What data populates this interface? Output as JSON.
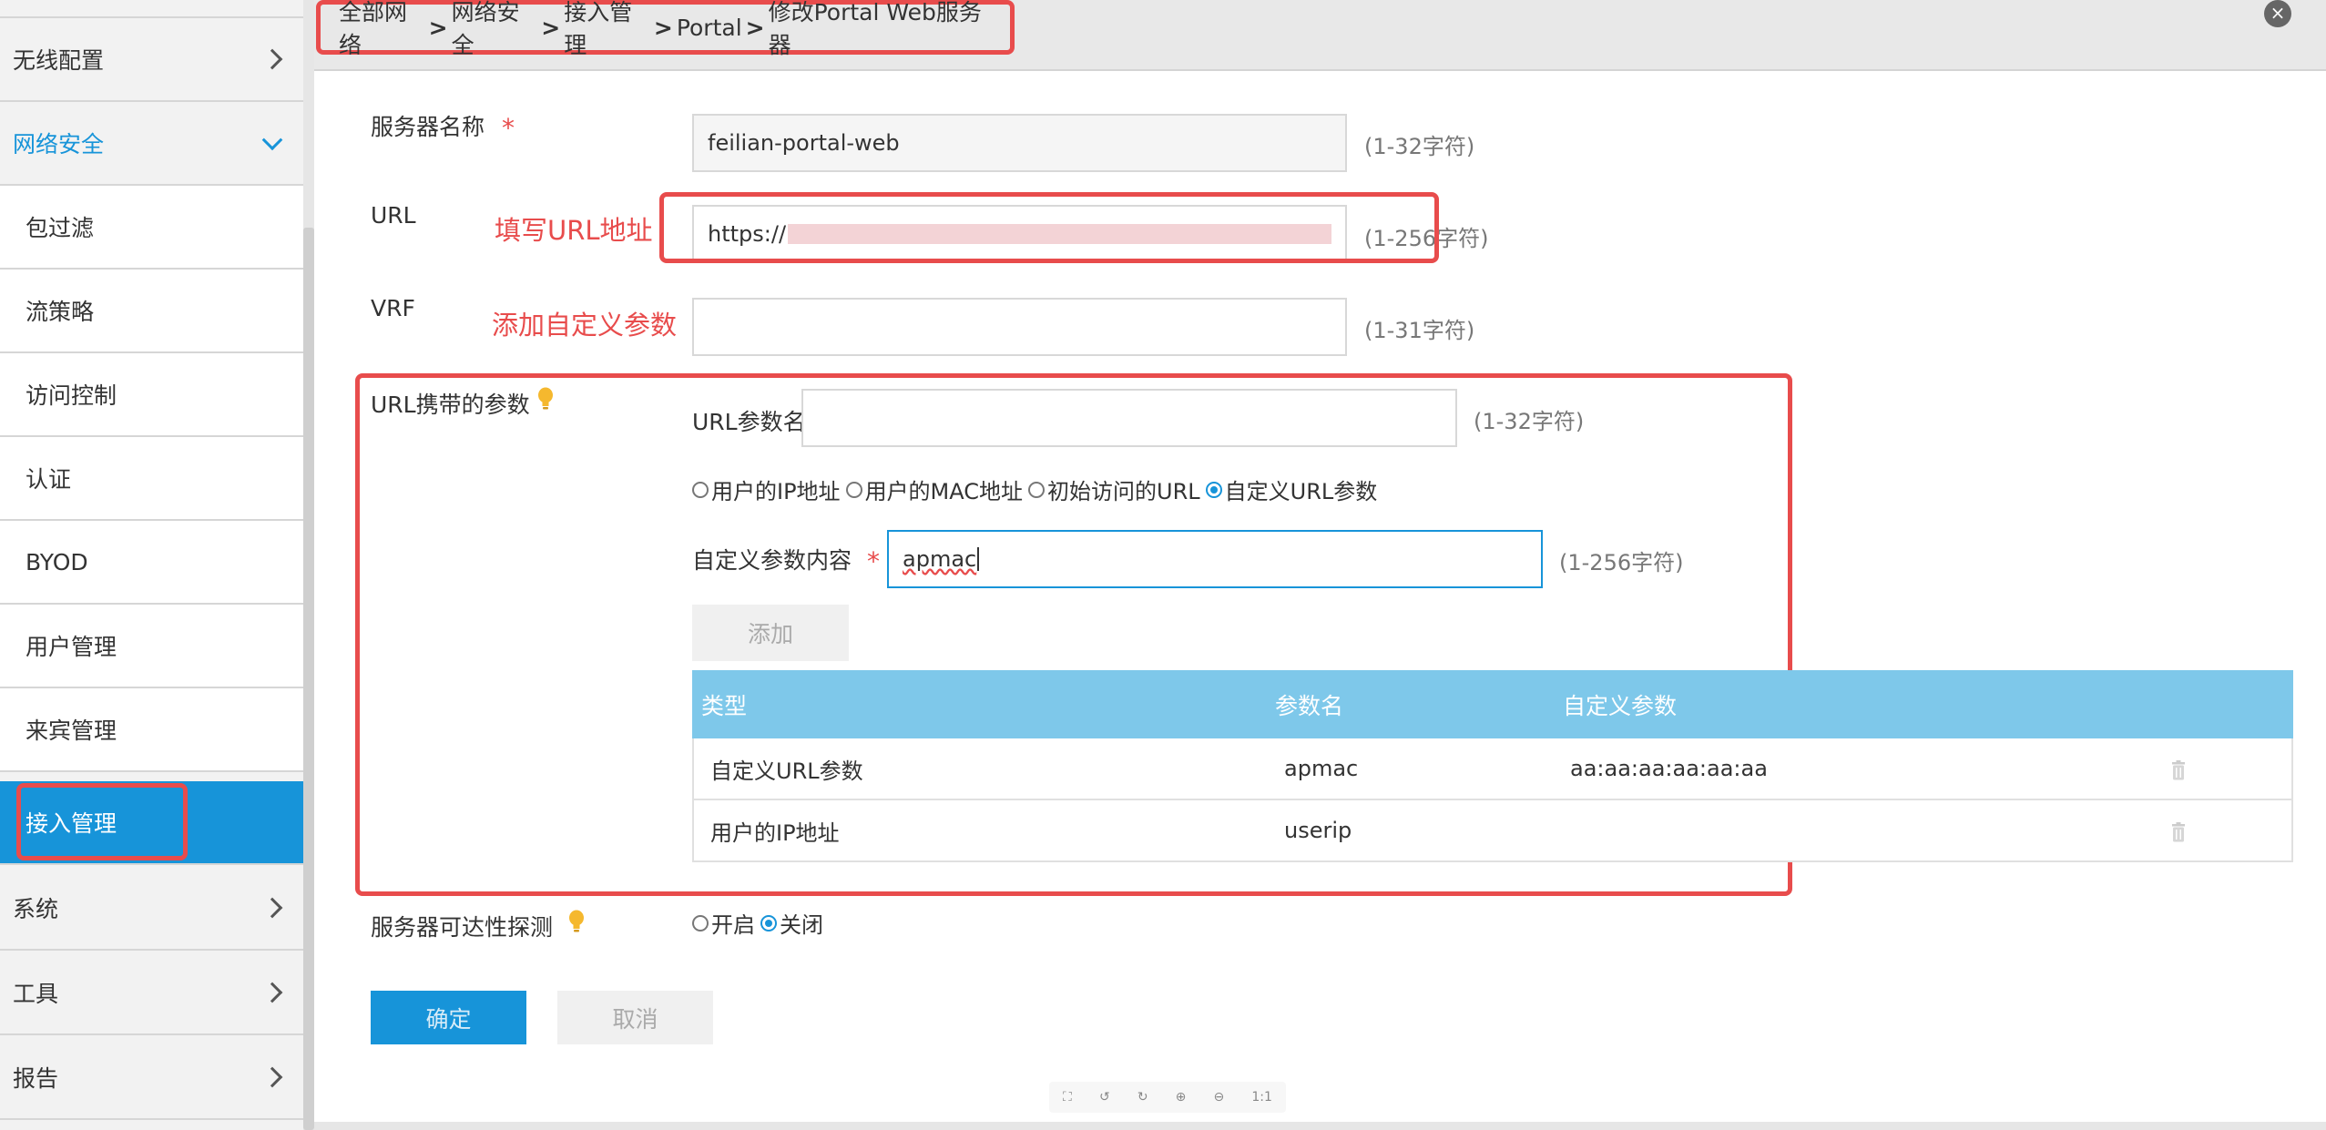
{
  "sidebar": {
    "items": [
      {
        "label": "无线配置"
      },
      {
        "label": "网络安全"
      },
      {
        "label": "包过滤"
      },
      {
        "label": "流策略"
      },
      {
        "label": "访问控制"
      },
      {
        "label": "认证"
      },
      {
        "label": "BYOD"
      },
      {
        "label": "用户管理"
      },
      {
        "label": "来宾管理"
      },
      {
        "label": "接入管理"
      },
      {
        "label": "系统"
      },
      {
        "label": "工具"
      },
      {
        "label": "报告"
      }
    ]
  },
  "breadcrumb": {
    "items": [
      "全部网络",
      "网络安全",
      "接入管理",
      "Portal",
      "修改Portal Web服务器"
    ],
    "separator": ">"
  },
  "close_label": "×",
  "form": {
    "server_name": {
      "label": "服务器名称",
      "required": "*",
      "value": "feilian-portal-web",
      "hint": "(1-32字符)"
    },
    "url": {
      "label": "URL",
      "value": "https://",
      "hint": "(1-256字符)"
    },
    "vrf": {
      "label": "VRF",
      "value": "",
      "hint": "(1-31字符)"
    },
    "url_params": {
      "label": "URL携带的参数",
      "param_name_label": "URL参数名",
      "param_name_value": "",
      "param_name_hint": "(1-32字符)",
      "options": [
        "用户的IP地址",
        "用户的MAC地址",
        "初始访问的URL",
        "自定义URL参数"
      ],
      "selected_option": "自定义URL参数",
      "custom_content_label": "自定义参数内容",
      "custom_content_required": "*",
      "custom_content_value": "apmac",
      "custom_content_hint": "(1-256字符)",
      "add_button": "添加"
    },
    "probe": {
      "label": "服务器可达性探测",
      "options": [
        "开启",
        "关闭"
      ],
      "selected": "关闭"
    },
    "confirm_button": "确定",
    "cancel_button": "取消"
  },
  "annotations": {
    "url_note": "填写URL地址",
    "params_note": "添加自定义参数"
  },
  "table": {
    "headers": [
      "类型",
      "参数名",
      "自定义参数"
    ],
    "rows": [
      {
        "type": "自定义URL参数",
        "name": "apmac",
        "custom": "aa:aa:aa:aa:aa:aa"
      },
      {
        "type": "用户的IP地址",
        "name": "userip",
        "custom": ""
      }
    ]
  },
  "zoombar": {
    "icons": [
      "fullscreen-icon",
      "rotate-left-icon",
      "rotate-right-icon",
      "zoom-in-icon",
      "zoom-out-icon"
    ],
    "ratio_label": "1:1"
  },
  "colors": {
    "accent": "#1794d9",
    "annotation_red": "#e84c4c",
    "table_header": "#7ec8ea",
    "bulb": "#f5b82e"
  }
}
